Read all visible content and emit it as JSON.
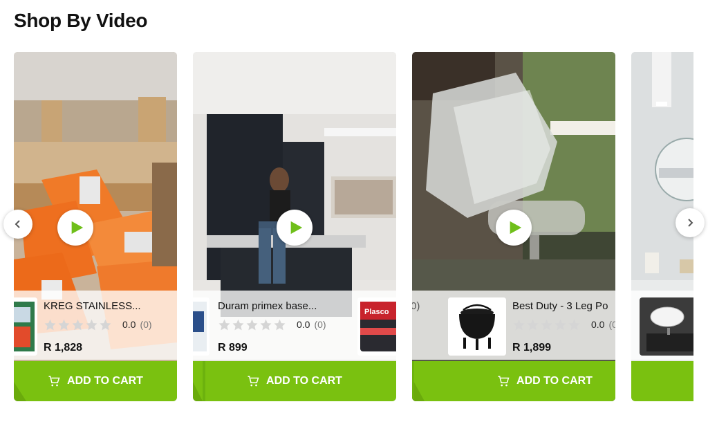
{
  "section": {
    "title": "Shop By Video"
  },
  "products": [
    {
      "name": "KREG STAINLESS...",
      "rating": "0.0",
      "reviews": "(0)",
      "price": "R 1,828",
      "cart_label": "ADD TO CART"
    },
    {
      "name": "Duram primex base...",
      "rating": "0.0",
      "reviews": "(0)",
      "price": "R 899",
      "cart_label": "ADD TO CART"
    },
    {
      "name": "Best Duty - 3 Leg Po",
      "rating": "0.0",
      "reviews": "(0",
      "price": "R 1,899",
      "cart_label": "ADD TO CART"
    }
  ],
  "partial": {
    "peek_reviews": "0)",
    "peek_brand": "Plasco"
  },
  "icons": {
    "play": "play-icon",
    "cart": "cart-icon",
    "prev": "chevron-left-icon",
    "next": "chevron-right-icon",
    "star": "star-icon"
  },
  "colors": {
    "accent": "#7ac110",
    "play": "#6fbf1a",
    "star": "#d5d5d5"
  }
}
